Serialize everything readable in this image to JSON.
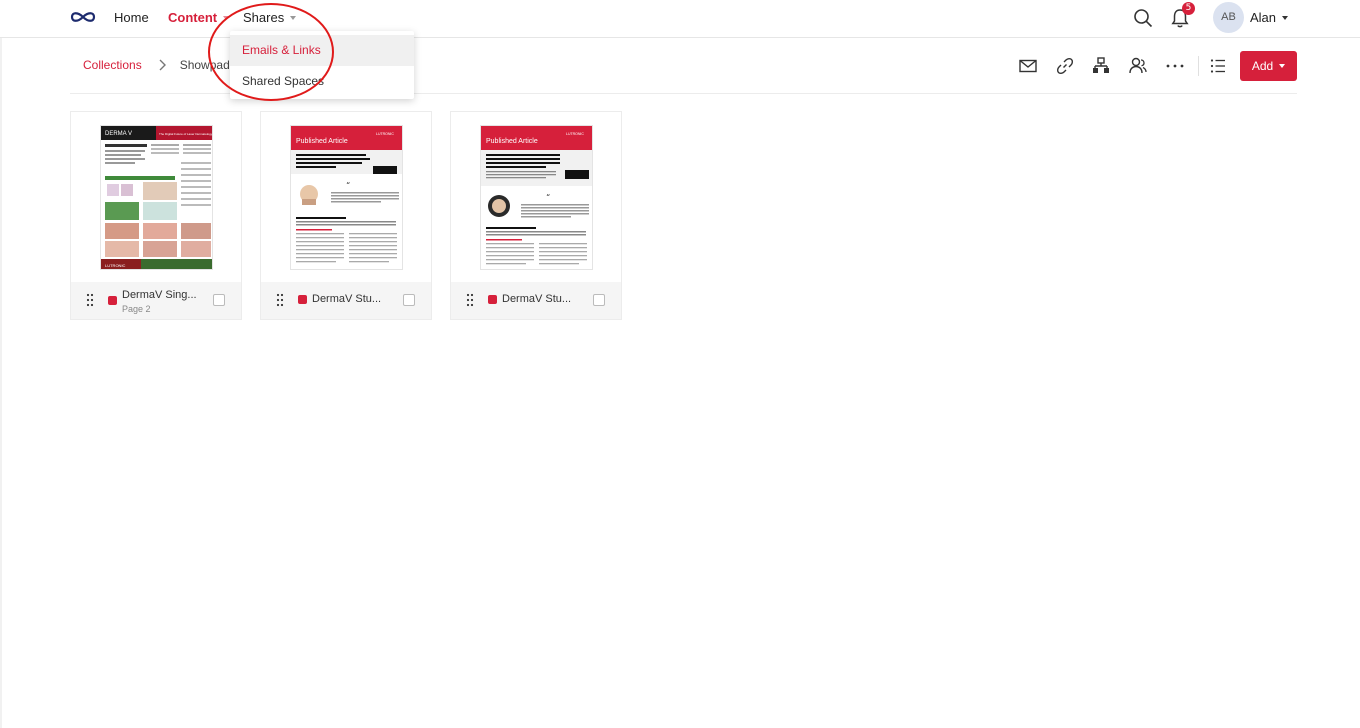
{
  "nav": {
    "home": "Home",
    "content": "Content",
    "shares": "Shares",
    "notifications_count": "5",
    "user_initials": "AB",
    "user_name": "Alan",
    "logo_icon": "infinity-logo",
    "search_icon": "search-icon",
    "bell_icon": "bell-icon"
  },
  "dropdown": {
    "items": [
      "Emails & Links",
      "Shared Spaces"
    ]
  },
  "breadcrumb": {
    "root": "Collections",
    "current": "Showpad Co"
  },
  "toolbar": {
    "add_label": "Add",
    "icons": [
      "mail-icon",
      "link-icon",
      "org-chart-icon",
      "users-icon",
      "more-icon",
      "list-view-icon"
    ]
  },
  "cards": [
    {
      "title": "DermaV Sing...",
      "subtitle": "Page 2"
    },
    {
      "title": "DermaV Stu..."
    },
    {
      "title": "DermaV Stu..."
    }
  ],
  "thumbnails": {
    "doc1": {
      "brand": "DERMA V",
      "headline": "The Digital Future of Laser Dermatology",
      "footer_brand": "LUTRONIC"
    },
    "doc2": {
      "banner": "Published Article",
      "brand": "LUTRONIC",
      "headline": "A new 532 nm, variable-pulse-structure, dual-wavelength, KTP laser incorporating cryogen spray cooling, effectively treats rosacea",
      "section": "What's covered in the article?"
    },
    "doc3": {
      "banner": "Published Article",
      "brand": "LUTRONIC",
      "headline": "Safety and Efficacy of a Novel, Variable-Sequenced, Long-Pulsed, 532-nm and 1,064-nm Laser With Cryogen Spray Cooling for Pigmented and Vascular Lesions",
      "section": "What's covered in the article?"
    }
  },
  "colors": {
    "accent": "#d6203b",
    "logo": "#1d2b6e"
  }
}
